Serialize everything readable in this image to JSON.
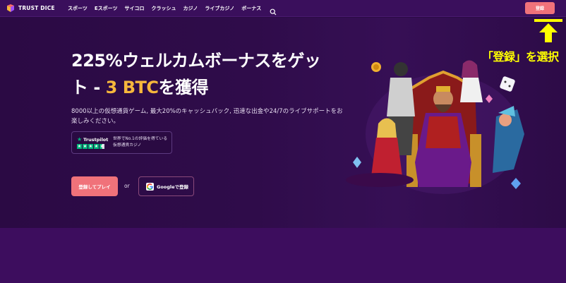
{
  "header": {
    "logo_text": "TRUST DICE",
    "nav": [
      "スポーツ",
      "Eスポーツ",
      "サイコロ",
      "クラッシュ",
      "カジノ",
      "ライブカジノ",
      "ボーナス"
    ],
    "register_label": "登録"
  },
  "hero": {
    "title_line1": "225%ウェルカムボーナスをゲッ",
    "title_line2_prefix": "ト - ",
    "title_line2_accent": "3 BTC",
    "title_line2_suffix": "を獲得",
    "description": "8000以上の仮想通貨ゲーム, 最大20%のキャッシュバック, 迅速な出金や24/7のライブサポートをお楽しみください。",
    "trustpilot": {
      "brand": "Trustpilot",
      "stars": 4.5,
      "text": "世界でNo.1の評価を得ている仮想通貨カジノ"
    },
    "play_label": "登録してプレイ",
    "or_label": "or",
    "google_label": "Googleで登録"
  },
  "annotation": {
    "text": "「登録」を選択"
  },
  "colors": {
    "accent": "#f6b73c",
    "button": "#f0727a",
    "header_bg": "#3a0f5c",
    "page_bg": "#2a0a44",
    "annotation": "#ffff00"
  }
}
